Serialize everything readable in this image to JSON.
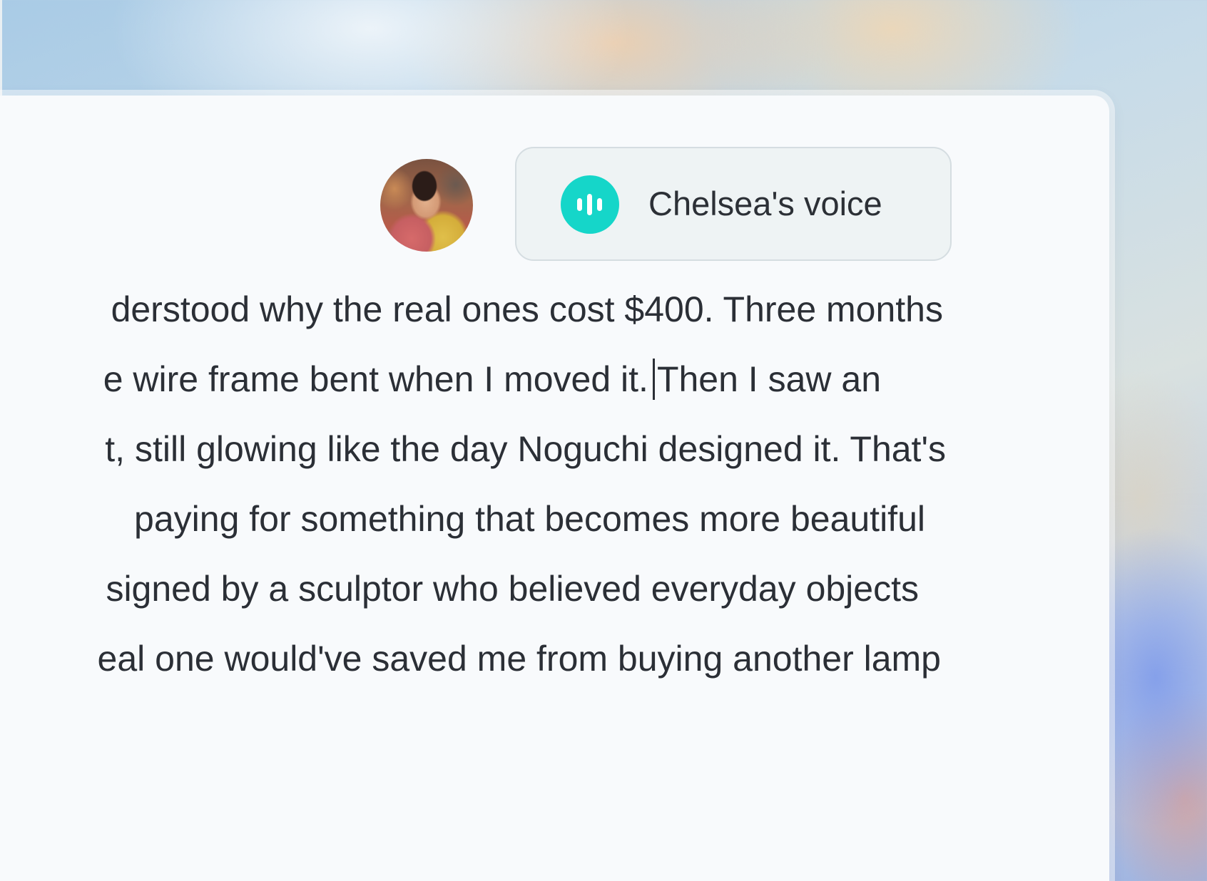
{
  "voice": {
    "label": "Chelsea's voice",
    "icon": "audio-waveform-icon",
    "accent_color": "#15d6c9"
  },
  "avatar": {
    "alt": "Chelsea"
  },
  "document": {
    "lines": [
      "derstood why the real ones cost $400. Three months",
      "e wire frame bent when I moved it.",
      "Then I saw an",
      "t, still glowing like the day Noguchi designed it. That's",
      " paying for something that becomes more beautiful",
      "signed by a sculptor who believed everyday objects",
      "eal one would've saved me from buying another lamp"
    ]
  }
}
